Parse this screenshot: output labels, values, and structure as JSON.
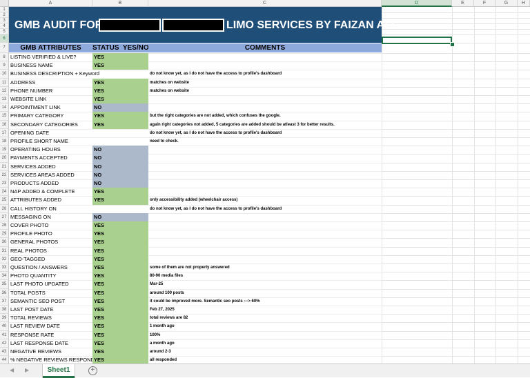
{
  "columns": [
    "A",
    "B",
    "C",
    "D",
    "E",
    "F",
    "G",
    "H"
  ],
  "selected_column": "D",
  "selected_row": 6,
  "banner": {
    "left": "GMB AUDIT FOR",
    "right": "LIMO SERVICES BY FAIZAN ALI"
  },
  "header": {
    "attributes": "GMB ATTRIBUTES",
    "status": "STATUS  YES/NO",
    "comments": "COMMENTS"
  },
  "rows": [
    {
      "attr": "LISTING VERIFIED & LIVE?",
      "status": "YES",
      "comment": ""
    },
    {
      "attr": "BUSINESS NAME",
      "status": "YES",
      "comment": ""
    },
    {
      "attr": "BUSINESS DESCRIPTION + Keyword",
      "status": "",
      "comment": "do not know yet, as I do not have the access to profile's dashboard"
    },
    {
      "attr": "ADDRESS",
      "status": "YES",
      "comment": "matches on website"
    },
    {
      "attr": "PHONE NUMBER",
      "status": "YES",
      "comment": "matches on website"
    },
    {
      "attr": "WEBSITE LINK",
      "status": "YES",
      "comment": ""
    },
    {
      "attr": "APPOINTMENT LINK",
      "status": "NO",
      "comment": ""
    },
    {
      "attr": "PRIMARY CATEGORY",
      "status": "YES",
      "comment": "but the right categories are not added, which confuses the google."
    },
    {
      "attr": "SECONDARY CATEGORIES",
      "status": "YES",
      "comment": "again right categories not added, 5 categories are added should be atleast 3 for better results."
    },
    {
      "attr": "OPENING DATE",
      "status": "",
      "comment": "do not know yet, as I do not have the access to profile's dashboard"
    },
    {
      "attr": "PROFILE SHORT NAME",
      "status": "",
      "comment": "need to check."
    },
    {
      "attr": "OPERATING HOURS",
      "status": "NO",
      "comment": ""
    },
    {
      "attr": "PAYMENTS ACCEPTED",
      "status": "NO",
      "comment": ""
    },
    {
      "attr": "SERVICES ADDED",
      "status": "NO",
      "comment": ""
    },
    {
      "attr": "SERVICES AREAS ADDED",
      "status": "NO",
      "comment": ""
    },
    {
      "attr": "PRODUCTS ADDED",
      "status": "NO",
      "comment": ""
    },
    {
      "attr": "NAP ADDED & COMPLETE",
      "status": "YES",
      "comment": ""
    },
    {
      "attr": "ATTRIBUTES ADDED",
      "status": "YES",
      "comment": "only accessibility added (wheelchair access)"
    },
    {
      "attr": "CALL HISTORY ON",
      "status": "",
      "comment": "do not know yet, as I do not have the access to profile's dashboard"
    },
    {
      "attr": "MESSAGING ON",
      "status": "NO",
      "comment": ""
    },
    {
      "attr": "COVER PHOTO",
      "status": "YES",
      "comment": ""
    },
    {
      "attr": "PROFILE PHOTO",
      "status": "YES",
      "comment": ""
    },
    {
      "attr": "GENERAL PHOTOS",
      "status": "YES",
      "comment": ""
    },
    {
      "attr": "REAL PHOTOS",
      "status": "YES",
      "comment": ""
    },
    {
      "attr": "GEO-TAGGED",
      "status": "YES",
      "comment": ""
    },
    {
      "attr": "QUESTION / ANSWERS",
      "status": "YES",
      "comment": "some of them are not properly answered"
    },
    {
      "attr": "PHOTO QUANTITY",
      "status": "YES",
      "comment": "80-90 media files"
    },
    {
      "attr": "LAST PHOTO UPDATED",
      "status": "YES",
      "comment": "Mar-25"
    },
    {
      "attr": "TOTAL POSTS",
      "status": "YES",
      "comment": "around 100 posts"
    },
    {
      "attr": "SEMANTIC SEO POST",
      "status": "YES",
      "comment": "it could be improved more. Semantic seo posts ---> 60%"
    },
    {
      "attr": "LAST POST DATE",
      "status": "YES",
      "comment": "Feb 27, 2025"
    },
    {
      "attr": "TOTAL REVIEWS",
      "status": "YES",
      "comment": "total reviews are 82"
    },
    {
      "attr": "LAST REVIEW DATE",
      "status": "YES",
      "comment": "1 month ago"
    },
    {
      "attr": "RESPONSE RATE",
      "status": "YES",
      "comment": "100%"
    },
    {
      "attr": "LAST RESPONSE DATE",
      "status": "YES",
      "comment": "a month ago"
    },
    {
      "attr": "NEGATIVE REVIEWS",
      "status": "YES",
      "comment": "around 2-3"
    },
    {
      "attr": "% NEGATIVE REVIEWS RESPONDE",
      "status": "YES",
      "comment": "all responded"
    }
  ],
  "tabbar": {
    "prev_icon": "chevron-left-icon",
    "next_icon": "chevron-right-icon",
    "sheet_name": "Sheet1",
    "add_icon": "plus-circle-icon"
  },
  "colors": {
    "banner": "#1f4e79",
    "header": "#8ea9db",
    "yes": "#a9d08e",
    "no": "#acb9ca",
    "accent": "#217346"
  }
}
